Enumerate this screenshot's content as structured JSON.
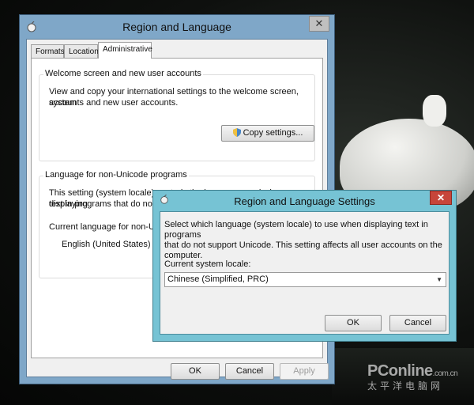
{
  "main_window": {
    "title": "Region and Language",
    "close_glyph": "✕",
    "tabs": [
      {
        "label": "Formats"
      },
      {
        "label": "Location"
      },
      {
        "label": "Administrative"
      }
    ],
    "welcome_group": {
      "title": "Welcome screen and new user accounts",
      "line1": "View and copy your international settings to the welcome screen, system",
      "line2": "accounts and new user accounts.",
      "copy_button": "Copy settings..."
    },
    "unicode_group": {
      "title": "Language for non-Unicode programs",
      "line1": "This setting (system locale) controls the language used when displaying",
      "line2": "text in programs that do not su",
      "current_label": "Current language for non-Unic",
      "current_value": "English (United States)"
    },
    "buttons": {
      "ok": "OK",
      "cancel": "Cancel",
      "apply": "Apply"
    }
  },
  "dialog": {
    "title": "Region and Language Settings",
    "close_glyph": "✕",
    "line1": "Select which language (system locale) to use when displaying text in programs",
    "line2": "that do not support Unicode. This setting affects all user accounts on the",
    "line3": "computer.",
    "locale_label": "Current system locale:",
    "locale_value": "Chinese (Simplified, PRC)",
    "buttons": {
      "ok": "OK",
      "cancel": "Cancel"
    }
  },
  "watermark": {
    "brand": "PConline",
    "suffix": ".com.cn",
    "chinese": "太平洋电脑网"
  },
  "icons": [
    "globe-icon",
    "shield-icon",
    "dropdown-arrow-icon",
    "close-icon"
  ]
}
